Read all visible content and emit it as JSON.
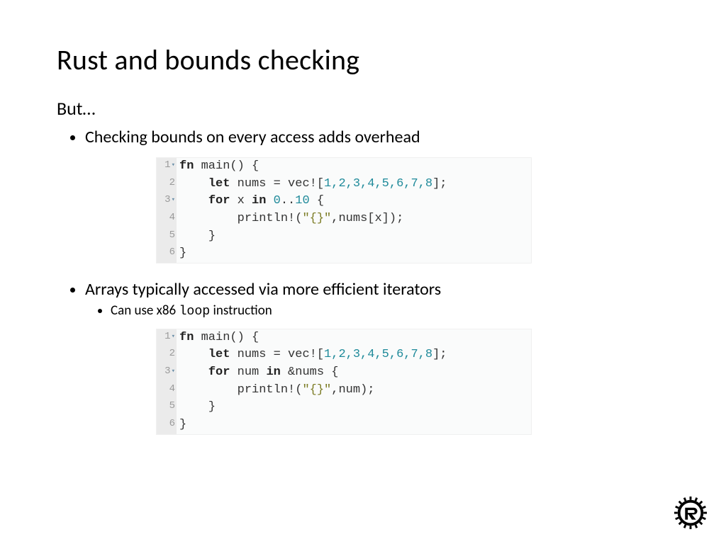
{
  "title": "Rust and bounds checking",
  "subtitle": "But…",
  "bullets": {
    "b1": "Checking bounds on every access adds overhead",
    "b2": "Arrays typically accessed via more efficient iterators",
    "b2_sub_pre": "Can use x86 ",
    "b2_sub_code": "loop",
    "b2_sub_post": " instruction"
  },
  "code1": {
    "gutter": [
      "1",
      "2",
      "3",
      "4",
      "5",
      "6"
    ],
    "fold_markers": [
      true,
      false,
      true,
      false,
      false,
      false
    ],
    "lines": {
      "l1_kw": "fn",
      "l1_rest_a": " main() ",
      "l1_brace": "{",
      "l2_indent": "    ",
      "l2_kw": "let",
      "l2_a": " nums = vec![",
      "l2_nums": "1,2,3,4,5,6,7,8",
      "l2_b": "];",
      "l3_indent": "    ",
      "l3_kw1": "for",
      "l3_a": " x ",
      "l3_kw2": "in",
      "l3_b": " ",
      "l3_n1": "0",
      "l3_dots": "..",
      "l3_n2": "10",
      "l3_c": " ",
      "l3_brace": "{",
      "l4_indent": "        ",
      "l4_a": "println!(",
      "l4_str": "\"{}\"",
      "l4_b": ",nums[x]);",
      "l5_indent": "    ",
      "l5_brace": "}",
      "l6_brace": "}"
    }
  },
  "code2": {
    "gutter": [
      "1",
      "2",
      "3",
      "4",
      "5",
      "6"
    ],
    "fold_markers": [
      true,
      false,
      true,
      false,
      false,
      false
    ],
    "lines": {
      "l1_kw": "fn",
      "l1_rest_a": " main() ",
      "l1_brace": "{",
      "l2_indent": "    ",
      "l2_kw": "let",
      "l2_a": " nums = vec![",
      "l2_nums": "1,2,3,4,5,6,7,8",
      "l2_b": "];",
      "l3_indent": "    ",
      "l3_kw1": "for",
      "l3_a": " num ",
      "l3_kw2": "in",
      "l3_b": " &nums ",
      "l3_brace": "{",
      "l4_indent": "        ",
      "l4_a": "println!(",
      "l4_str": "\"{}\"",
      "l4_b": ",num);",
      "l5_indent": "    ",
      "l5_brace": "}",
      "l6_brace": "}"
    }
  },
  "logo_alt": "rust-logo"
}
